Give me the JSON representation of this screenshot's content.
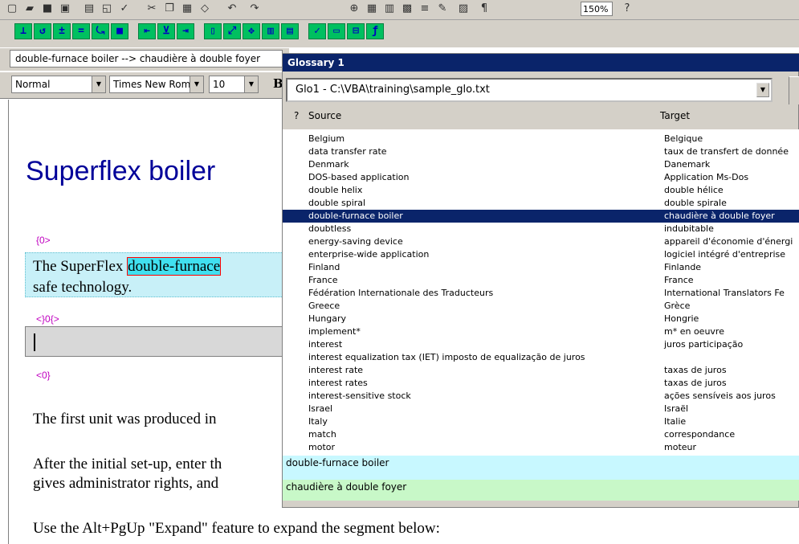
{
  "toolbar_top": {
    "zoom": "150%",
    "colors": {
      "bg": "#d4d0c8"
    }
  },
  "toolbar_tags": {
    "buttons": [
      "tag-icon-1",
      "tag-icon-2",
      "tag-icon-3",
      "tag-icon-4",
      "tag-icon-5",
      "tag-icon-6",
      "tag-icon-7",
      "tag-icon-8",
      "tag-icon-9",
      "tag-icon-10",
      "tag-icon-11",
      "tag-icon-12",
      "tag-icon-13",
      "tag-icon-14",
      "tag-icon-15",
      "tag-icon-16",
      "tag-icon-17",
      "tag-icon-18"
    ]
  },
  "status_field": "double-furnace boiler  -->  chaudière à double foyer",
  "format_bar": {
    "style": "Normal",
    "font": "Times New Roman",
    "size": "10",
    "bold": "B"
  },
  "document": {
    "heading": "Superflex boiler",
    "tag_open": "{0>",
    "segment_before": "The SuperFlex ",
    "segment_term": "double-furnace",
    "segment_line2": "safe technology.",
    "tag_mid": "<}0{>",
    "tag_close": "<0}",
    "para1": " The first unit was produced in",
    "para2_line1": "After the initial set-up, enter th",
    "para2_line2": "gives administrator rights, and",
    "para3": "Use the Alt+PgUp \"Expand\" feature to expand the segment below:"
  },
  "glossary": {
    "title": "Glossary 1",
    "file": "Glo1 - C:\\VBA\\training\\sample_glo.txt",
    "col_q": "?",
    "col_source": "Source",
    "col_target": "Target",
    "selected_index": 6,
    "rows": [
      {
        "src": "Belgium",
        "tgt": "Belgique"
      },
      {
        "src": "data transfer rate",
        "tgt": "taux de transfert de donnée"
      },
      {
        "src": "Denmark",
        "tgt": "Danemark"
      },
      {
        "src": "DOS-based application",
        "tgt": "Application Ms-Dos"
      },
      {
        "src": "double helix",
        "tgt": "double hélice"
      },
      {
        "src": "double spiral",
        "tgt": "double spirale"
      },
      {
        "src": "double-furnace boiler",
        "tgt": "chaudière à double foyer"
      },
      {
        "src": "doubtless",
        "tgt": "indubitable"
      },
      {
        "src": "energy-saving device",
        "tgt": "appareil d'économie d'énergi"
      },
      {
        "src": "enterprise-wide application",
        "tgt": "logiciel intégré d'entreprise"
      },
      {
        "src": "Finland",
        "tgt": "Finlande"
      },
      {
        "src": "France",
        "tgt": "France"
      },
      {
        "src": "Fédération Internationale des Traducteurs",
        "tgt": "International Translators Fe"
      },
      {
        "src": "Greece",
        "tgt": "Grèce"
      },
      {
        "src": "Hungary",
        "tgt": "Hongrie"
      },
      {
        "src": "implement*",
        "tgt": "m* en oeuvre"
      },
      {
        "src": "interest",
        "tgt": "juros participação"
      },
      {
        "src": "interest equalization tax (IET) imposto de equalização de juros",
        "tgt": ""
      },
      {
        "src": "interest rate",
        "tgt": "taxas de juros"
      },
      {
        "src": "interest rates",
        "tgt": "taxas de juros"
      },
      {
        "src": "interest-sensitive stock",
        "tgt": "ações sensíveis aos juros"
      },
      {
        "src": "Israel",
        "tgt": "Israël"
      },
      {
        "src": "Italy",
        "tgt": "Italie"
      },
      {
        "src": "match",
        "tgt": "correspondance"
      },
      {
        "src": "motor",
        "tgt": "moteur"
      }
    ],
    "source_preview": "double-furnace boiler",
    "target_preview": "chaudière à double foyer",
    "colors": {
      "titlebar": "#0a246a",
      "selection": "#0a246a",
      "source_preview_bg": "#c8f8ff",
      "target_preview_bg": "#c8f8c8"
    }
  }
}
